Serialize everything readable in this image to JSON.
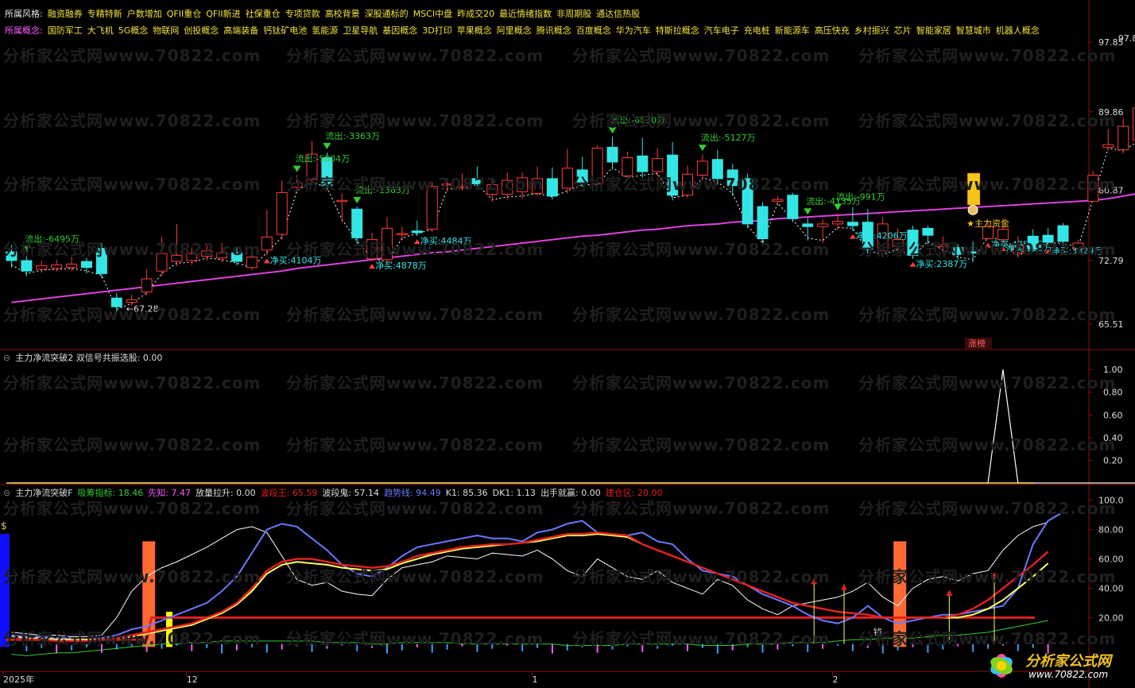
{
  "header": {
    "style_label": "所属风格:",
    "style_tags": [
      "融资融券",
      "专精特新",
      "户数增加",
      "QFII重仓",
      "QFII新进",
      "社保重仓",
      "专项贷款",
      "高校背景",
      "深股通标的",
      "MSCI中盘",
      "昨成交20",
      "最近情绪指数",
      "非周期股",
      "通达信热股"
    ],
    "concept_label": "所属概念:",
    "concept_tags": [
      "国防军工",
      "大飞机",
      "5G概念",
      "物联网",
      "创投概念",
      "高端装备",
      "钙钛矿电池",
      "氢能源",
      "卫星导航",
      "基因概念",
      "3D打印",
      "苹果概念",
      "阿里概念",
      "腾讯概念",
      "百度概念",
      "华为汽车",
      "特斯拉概念",
      "汽车电子",
      "充电桩",
      "新能源车",
      "高压快充",
      "乡村振兴",
      "芯片",
      "智能家居",
      "智慧城市",
      "机器人概念"
    ]
  },
  "watermark": "分析家公式网www.70822.com",
  "colors": {
    "up": "#ff3a3a",
    "down": "#33e6e6",
    "ma": "#e040e0",
    "white": "#ffffff",
    "yellow": "#ffff66",
    "red": "#e02020",
    "blue": "#6a78ff",
    "green": "#33cc33",
    "pink": "#ff5aff",
    "gold": "#f5c518",
    "orange": "#ff6a33"
  },
  "chart_data": [
    {
      "type": "candlestick",
      "panel": "main",
      "y_ticks": [
        "97.85",
        "89.86",
        "80.87",
        "72.79",
        "65.51"
      ],
      "ylim": [
        63.5,
        98.5
      ],
      "candles": [
        [
          73.8,
          72.8,
          74.6,
          72.0
        ],
        [
          72.8,
          71.6,
          73.4,
          71.0
        ],
        [
          71.8,
          72.2,
          72.8,
          71.4
        ],
        [
          71.9,
          72.3,
          72.9,
          71.5
        ],
        [
          72.0,
          72.4,
          73.2,
          71.6
        ],
        [
          72.7,
          72.0,
          73.1,
          71.3
        ],
        [
          74.2,
          71.3,
          74.8,
          70.8
        ],
        [
          68.5,
          67.5,
          69.1,
          66.9
        ],
        [
          68.0,
          68.3,
          68.9,
          67.6
        ],
        [
          69.2,
          70.7,
          71.8,
          68.8
        ],
        [
          71.6,
          73.6,
          75.5,
          71.0
        ],
        [
          72.7,
          73.4,
          77.0,
          72.2
        ],
        [
          72.8,
          73.6,
          74.3,
          72.3
        ],
        [
          73.3,
          73.9,
          74.7,
          72.8
        ],
        [
          73.1,
          73.7,
          74.8,
          72.6
        ],
        [
          73.7,
          72.7,
          74.4,
          72.2
        ],
        [
          72.0,
          73.2,
          74.3,
          71.7
        ],
        [
          74.0,
          75.5,
          78.6,
          73.4
        ],
        [
          75.8,
          80.6,
          82.0,
          75.2
        ],
        [
          81.2,
          81.7,
          82.6,
          80.5
        ],
        [
          82.1,
          85.0,
          86.5,
          81.5
        ],
        [
          84.6,
          81.4,
          85.2,
          80.9
        ],
        [
          79.6,
          79.7,
          80.5,
          77.2
        ],
        [
          78.7,
          75.4,
          79.0,
          74.7
        ],
        [
          73.0,
          75.2,
          76.0,
          72.8
        ],
        [
          72.9,
          76.5,
          77.8,
          72.3
        ],
        [
          75.8,
          75.9,
          76.7,
          75.1
        ],
        [
          76.2,
          76.0,
          77.4,
          75.6
        ],
        [
          76.4,
          81.3,
          81.8,
          76.1
        ],
        [
          81.6,
          81.6,
          82.0,
          80.7
        ],
        [
          81.2,
          81.3,
          82.8,
          80.8
        ],
        [
          82.2,
          81.6,
          83.6,
          81.2
        ],
        [
          80.4,
          81.5,
          82.3,
          79.5
        ],
        [
          80.4,
          82.0,
          82.9,
          79.8
        ],
        [
          80.7,
          82.3,
          82.9,
          79.9
        ],
        [
          80.5,
          82.2,
          83.6,
          80.2
        ],
        [
          82.2,
          80.2,
          83.5,
          79.8
        ],
        [
          81.1,
          83.4,
          85.6,
          80.5
        ],
        [
          83.2,
          81.7,
          84.7,
          81.2
        ],
        [
          81.6,
          85.7,
          86.0,
          81.2
        ],
        [
          85.8,
          84.1,
          87.0,
          83.2
        ],
        [
          82.5,
          84.6,
          85.3,
          82.0
        ],
        [
          84.8,
          83.0,
          86.9,
          82.3
        ],
        [
          83.0,
          84.5,
          85.7,
          82.5
        ],
        [
          84.9,
          80.3,
          86.4,
          79.7
        ],
        [
          80.3,
          82.7,
          83.7,
          80.0
        ],
        [
          82.6,
          84.2,
          85.0,
          82.0
        ],
        [
          84.4,
          82.2,
          85.5,
          81.5
        ],
        [
          83.2,
          81.4,
          83.9,
          80.2
        ],
        [
          82.2,
          77.0,
          82.8,
          76.5
        ],
        [
          79.0,
          75.3,
          79.5,
          74.5
        ],
        [
          79.6,
          79.8,
          80.2,
          79.1
        ],
        [
          80.3,
          77.6,
          80.6,
          77.2
        ],
        [
          77.0,
          76.7,
          77.7,
          75.1
        ],
        [
          76.7,
          77.0,
          77.5,
          74.8
        ],
        [
          77.0,
          77.3,
          78.2,
          76.3
        ],
        [
          77.2,
          76.8,
          78.9,
          76.2
        ],
        [
          77.2,
          74.1,
          78.7,
          73.6
        ],
        [
          73.9,
          77.0,
          77.8,
          73.2
        ],
        [
          74.4,
          75.2,
          76.5,
          73.8
        ],
        [
          76.3,
          73.4,
          76.8,
          73.0
        ],
        [
          76.5,
          75.7,
          76.8,
          74.7
        ],
        [
          74.4,
          74.6,
          75.6,
          73.7
        ],
        [
          74.3,
          73.5,
          74.7,
          72.9
        ],
        [
          73.8,
          73.7,
          75.0,
          72.6
        ],
        [
          75.3,
          76.7,
          77.3,
          75.2
        ],
        [
          75.2,
          76.4,
          77.6,
          74.8
        ],
        [
          73.7,
          74.6,
          75.6,
          73.1
        ],
        [
          75.6,
          74.1,
          76.4,
          73.8
        ],
        [
          75.7,
          74.9,
          76.5,
          74.5
        ],
        [
          76.8,
          75.0,
          77.1,
          74.5
        ],
        [
          74.1,
          74.8,
          75.2,
          74.0
        ],
        [
          79.6,
          82.6,
          83.1,
          79.6
        ],
        [
          85.8,
          86.1,
          87.9,
          85.4
        ],
        [
          85.5,
          88.2,
          89.1,
          85.1
        ],
        [
          86.6,
          90.3,
          90.8,
          86.2
        ],
        [
          89.3,
          95.0,
          97.9,
          88.9
        ]
      ],
      "ma_line": [
        68.0,
        68.2,
        68.4,
        68.6,
        68.8,
        69.0,
        69.2,
        69.4,
        69.6,
        69.8,
        70.0,
        70.2,
        70.4,
        70.6,
        70.8,
        71.0,
        71.2,
        71.4,
        71.6,
        71.9,
        72.1,
        72.3,
        72.5,
        72.7,
        72.9,
        73.1,
        73.3,
        73.5,
        73.7,
        73.8,
        74.0,
        74.2,
        74.4,
        74.6,
        74.8,
        75.0,
        75.2,
        75.4,
        75.6,
        75.7,
        75.9,
        76.1,
        76.3,
        76.4,
        76.6,
        76.8,
        76.9,
        77.0,
        77.2,
        77.3,
        77.4,
        77.6,
        77.7,
        77.8,
        77.9,
        78.0,
        78.1,
        78.2,
        78.3,
        78.4,
        78.5,
        78.6,
        78.7,
        78.8,
        78.9,
        79.0,
        79.1,
        79.2,
        79.3,
        79.4,
        79.5,
        79.6,
        79.7,
        79.9,
        80.2,
        80.5,
        80.8
      ],
      "annotations": [
        {
          "i": 1,
          "text": "流出:-6495万",
          "kind": "out"
        },
        {
          "i": 19,
          "text": "流出:-5804万",
          "kind": "out"
        },
        {
          "i": 21,
          "text": "流出:-3363万",
          "kind": "out"
        },
        {
          "i": 23,
          "text": "流出:-1363万",
          "kind": "out"
        },
        {
          "i": 40,
          "text": "流出:-6630万",
          "kind": "out"
        },
        {
          "i": 46,
          "text": "流出:-5127万",
          "kind": "out"
        },
        {
          "i": 53,
          "text": "流出:-4135万",
          "kind": "out"
        },
        {
          "i": 55,
          "text": "流出:-991万",
          "kind": "out"
        },
        {
          "i": 17,
          "text": "净买:4104万",
          "kind": "in"
        },
        {
          "i": 24,
          "text": "净买:4878万",
          "kind": "in"
        },
        {
          "i": 27,
          "text": "净买:4484万",
          "kind": "in"
        },
        {
          "i": 56,
          "text": "净买:4206万",
          "kind": "in"
        },
        {
          "i": 60,
          "text": "净买:2387万",
          "kind": "in"
        },
        {
          "i": 65,
          "text": "净买:4752万",
          "kind": "in"
        },
        {
          "i": 66,
          "text": "净买:995万",
          "kind": "in"
        },
        {
          "i": 69,
          "text": "净买:3829万",
          "kind": "in"
        }
      ],
      "marks": {
        "high_label": "97.85",
        "low_label": "67.28",
        "main_funds": "主力资金",
        "limit_up": "涨榜"
      }
    },
    {
      "type": "line",
      "panel": "indicator1",
      "title": "主力净流突破2 双信号共振选股: 0.00",
      "y_ticks": [
        "1.00",
        "0.80",
        "0.60",
        "0.40",
        "0.20"
      ],
      "ylim": [
        0,
        1.05
      ],
      "values": [
        0,
        0,
        0,
        0,
        0,
        0,
        0,
        0,
        0,
        0,
        0,
        0,
        0,
        0,
        0,
        0,
        0,
        0,
        0,
        0,
        0,
        0,
        0,
        0,
        0,
        0,
        0,
        0,
        0,
        0,
        0,
        0,
        0,
        0,
        0,
        0,
        0,
        0,
        0,
        0,
        0,
        0,
        0,
        0,
        0,
        0,
        0,
        0,
        0,
        0,
        0,
        0,
        0,
        0,
        0,
        0,
        0,
        0,
        0,
        0,
        0,
        0,
        0,
        0,
        0,
        0,
        1,
        0,
        0,
        0,
        0,
        0,
        0,
        0,
        0,
        0,
        0
      ]
    },
    {
      "type": "line",
      "panel": "indicator2",
      "title": "主力净流突破F",
      "legend": [
        {
          "label": "吸筹指标:",
          "value": "18.46",
          "color": "#33cc33"
        },
        {
          "label": "先知:",
          "value": "7.47",
          "color": "#ff5aff"
        },
        {
          "label": "放量拉升:",
          "value": "0.00",
          "color": "#dddddd"
        },
        {
          "label": "波段王:",
          "value": "65.59",
          "color": "#e02020"
        },
        {
          "label": "波段鬼:",
          "value": "57.14",
          "color": "#dddddd"
        },
        {
          "label": "趋势线:",
          "value": "94.49",
          "color": "#6a78ff"
        },
        {
          "label": "K1:",
          "value": "85.36",
          "color": "#dddddd"
        },
        {
          "label": "DK1:",
          "value": "1.13",
          "color": "#dddddd"
        },
        {
          "label": "出手就赢:",
          "value": "0.00",
          "color": "#dddddd"
        },
        {
          "label": "建仓区:",
          "value": "20.00",
          "color": "#e02020"
        }
      ],
      "y_ticks": [
        "100.0",
        "80.00",
        "60.00",
        "40.00",
        "20.00"
      ],
      "ylim": [
        -2,
        102
      ],
      "x_labels": [
        {
          "i": 0,
          "text": "2025年"
        },
        {
          "i": 12,
          "text": "12"
        },
        {
          "i": 35,
          "text": "1"
        },
        {
          "i": 55,
          "text": "2"
        }
      ],
      "white": [
        10,
        9,
        8,
        8,
        7,
        7,
        8,
        20,
        38,
        48,
        54,
        58,
        63,
        68,
        74,
        80,
        82,
        78,
        62,
        46,
        42,
        44,
        38,
        36,
        35,
        46,
        54,
        56,
        58,
        62,
        61,
        60,
        64,
        63,
        62,
        66,
        60,
        52,
        48,
        60,
        54,
        48,
        46,
        52,
        44,
        40,
        36,
        46,
        42,
        32,
        26,
        22,
        28,
        30,
        32,
        34,
        38,
        44,
        34,
        28,
        40,
        46,
        48,
        45,
        50,
        52,
        66,
        76,
        82,
        85
      ],
      "blue": [
        8,
        7,
        7,
        6,
        6,
        5,
        6,
        8,
        12,
        14,
        18,
        22,
        26,
        30,
        38,
        48,
        64,
        80,
        84,
        82,
        74,
        66,
        56,
        50,
        48,
        54,
        62,
        68,
        70,
        72,
        74,
        76,
        74,
        74,
        72,
        78,
        80,
        84,
        86,
        78,
        76,
        76,
        78,
        72,
        70,
        60,
        52,
        50,
        48,
        42,
        36,
        32,
        28,
        22,
        18,
        16,
        20,
        28,
        20,
        16,
        18,
        20,
        22,
        22,
        24,
        26,
        28,
        40,
        70,
        86,
        92
      ],
      "red": [
        6,
        5,
        5,
        4,
        4,
        4,
        5,
        6,
        8,
        10,
        12,
        14,
        16,
        20,
        24,
        30,
        40,
        52,
        58,
        60,
        60,
        58,
        56,
        55,
        54,
        55,
        58,
        62,
        64,
        66,
        68,
        69,
        70,
        70,
        71,
        73,
        75,
        77,
        77,
        78,
        77,
        76,
        70,
        66,
        62,
        58,
        54,
        50,
        46,
        42,
        38,
        34,
        30,
        28,
        26,
        24,
        23,
        22,
        20,
        20,
        20,
        20,
        20,
        22,
        26,
        32,
        40,
        48,
        56,
        65
      ],
      "yellow": [
        7,
        6,
        6,
        5,
        5,
        5,
        5,
        6,
        7,
        9,
        11,
        13,
        15,
        19,
        23,
        29,
        38,
        50,
        56,
        58,
        57,
        56,
        54,
        53,
        52,
        53,
        57,
        60,
        63,
        65,
        67,
        68,
        69,
        70,
        71,
        72,
        74,
        76,
        76,
        77,
        76,
        75,
        70,
        66,
        62,
        58,
        54,
        50,
        46,
        42,
        38,
        34,
        30,
        28,
        26,
        24,
        23,
        22,
        20,
        20,
        20,
        20,
        20,
        20,
        22,
        26,
        32,
        40,
        48,
        57
      ],
      "green": [
        -5,
        -6,
        -5,
        -4,
        -4,
        -3,
        -2,
        -1,
        0,
        1,
        2,
        2,
        3,
        3,
        4,
        4,
        4,
        4,
        4,
        4,
        4,
        3,
        3,
        3,
        2,
        2,
        3,
        3,
        3,
        3,
        2,
        2,
        2,
        2,
        2,
        2,
        2,
        1,
        1,
        1,
        1,
        2,
        2,
        2,
        2,
        2,
        1,
        1,
        1,
        2,
        2,
        2,
        3,
        3,
        3,
        4,
        5,
        5,
        6,
        6,
        6,
        7,
        8,
        8,
        9,
        10,
        12,
        14,
        16,
        18
      ],
      "accumulate_zone": 20,
      "orange_bars": [
        {
          "i": 8,
          "value": 72
        },
        {
          "i": 58,
          "value": 72
        }
      ],
      "yellow_bar": {
        "i": 10,
        "value": 24
      },
      "red_markers": [
        53,
        55,
        62,
        65
      ],
      "labels": {
        "money": "钱",
        "cat_left": "$"
      }
    }
  ],
  "logo": {
    "title": "分析家公式网",
    "url": "www.70822.com"
  }
}
